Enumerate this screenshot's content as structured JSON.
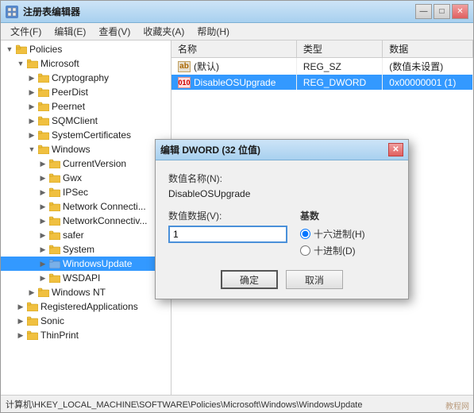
{
  "window": {
    "title": "注册表编辑器",
    "icon": "reg"
  },
  "titleButtons": {
    "minimize": "—",
    "maximize": "□",
    "close": "✕"
  },
  "menu": {
    "items": [
      {
        "label": "文件(F)"
      },
      {
        "label": "编辑(E)"
      },
      {
        "label": "查看(V)"
      },
      {
        "label": "收藏夹(A)"
      },
      {
        "label": "帮助(H)"
      }
    ]
  },
  "tree": {
    "items": [
      {
        "id": "policies",
        "label": "Policies",
        "indent": 0,
        "expanded": true,
        "hasChildren": true
      },
      {
        "id": "microsoft",
        "label": "Microsoft",
        "indent": 1,
        "expanded": true,
        "hasChildren": true
      },
      {
        "id": "cryptography",
        "label": "Cryptography",
        "indent": 2,
        "expanded": false,
        "hasChildren": true
      },
      {
        "id": "peerdist",
        "label": "PeerDist",
        "indent": 2,
        "expanded": false,
        "hasChildren": true
      },
      {
        "id": "peernet",
        "label": "Peernet",
        "indent": 2,
        "expanded": false,
        "hasChildren": true
      },
      {
        "id": "sqmclient",
        "label": "SQMClient",
        "indent": 2,
        "expanded": false,
        "hasChildren": true
      },
      {
        "id": "systemcertificates",
        "label": "SystemCertificates",
        "indent": 2,
        "expanded": false,
        "hasChildren": true
      },
      {
        "id": "windows",
        "label": "Windows",
        "indent": 2,
        "expanded": true,
        "hasChildren": true
      },
      {
        "id": "currentversion",
        "label": "CurrentVersion",
        "indent": 3,
        "expanded": false,
        "hasChildren": true
      },
      {
        "id": "gwx",
        "label": "Gwx",
        "indent": 3,
        "expanded": false,
        "hasChildren": true
      },
      {
        "id": "ipsec",
        "label": "IPSec",
        "indent": 3,
        "expanded": false,
        "hasChildren": true
      },
      {
        "id": "networkconnecti1",
        "label": "Network Connecti...",
        "indent": 3,
        "expanded": false,
        "hasChildren": true
      },
      {
        "id": "networkconnectiv2",
        "label": "NetworkConnectiv...",
        "indent": 3,
        "expanded": false,
        "hasChildren": true
      },
      {
        "id": "safer",
        "label": "safer",
        "indent": 3,
        "expanded": false,
        "hasChildren": true
      },
      {
        "id": "system",
        "label": "System",
        "indent": 3,
        "expanded": false,
        "hasChildren": true
      },
      {
        "id": "windowsupdate",
        "label": "WindowsUpdate",
        "indent": 3,
        "expanded": false,
        "hasChildren": true,
        "selected": true
      },
      {
        "id": "wsdapi",
        "label": "WSDAPI",
        "indent": 3,
        "expanded": false,
        "hasChildren": true
      },
      {
        "id": "windowsnt",
        "label": "Windows NT",
        "indent": 2,
        "expanded": false,
        "hasChildren": true
      },
      {
        "id": "registeredapps",
        "label": "RegisteredApplications",
        "indent": 1,
        "expanded": false,
        "hasChildren": true
      },
      {
        "id": "sonic",
        "label": "Sonic",
        "indent": 1,
        "expanded": false,
        "hasChildren": true
      },
      {
        "id": "thinprint",
        "label": "ThinPrint",
        "indent": 1,
        "expanded": false,
        "hasChildren": true
      }
    ]
  },
  "tableHeaders": [
    "名称",
    "类型",
    "数据"
  ],
  "tableRows": [
    {
      "icon": "ab",
      "iconColor": "#aa6600",
      "name": "(默认)",
      "type": "REG_SZ",
      "data": "(数值未设置)",
      "selected": false
    },
    {
      "icon": "dword",
      "iconColor": "#cc0000",
      "name": "DisableOSUpgrade",
      "type": "REG_DWORD",
      "data": "0x00000001 (1)",
      "selected": true
    }
  ],
  "statusBar": {
    "text": "计算机\\HKEY_LOCAL_MACHINE\\SOFTWARE\\Policies\\Microsoft\\Windows\\WindowsUpdate"
  },
  "dialog": {
    "title": "编辑 DWORD (32 位值)",
    "fieldNameLabel": "数值名称(N):",
    "fieldNameValue": "DisableOSUpgrade",
    "fieldDataLabel": "数值数据(V):",
    "fieldDataValue": "1",
    "baseLabel": "基数",
    "hexLabel": "十六进制(H)",
    "decLabel": "十进制(D)",
    "selectedBase": "hex",
    "confirmBtn": "确定",
    "cancelBtn": "取消",
    "closeBtn": "✕"
  },
  "watermark": "教程网"
}
